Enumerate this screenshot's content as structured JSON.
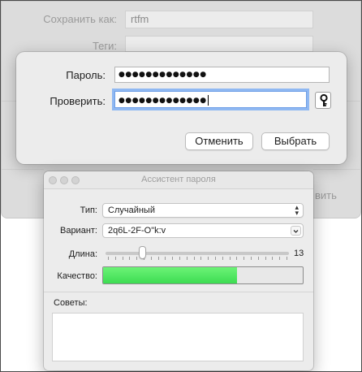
{
  "save_dialog": {
    "save_as_label": "Сохранить как:",
    "save_as_value": "rtfm",
    "tags_label": "Теги:",
    "partial_button": "вить"
  },
  "password_sheet": {
    "password_label": "Пароль:",
    "password_value": "●●●●●●●●●●●●●",
    "verify_label": "Проверить:",
    "verify_value": "●●●●●●●●●●●●●",
    "cancel_label": "Отменить",
    "choose_label": "Выбрать",
    "key_icon": "key-icon"
  },
  "assistant": {
    "title": "Ассистент пароля",
    "type_label": "Тип:",
    "type_value": "Случайный",
    "variant_label": "Вариант:",
    "variant_value": "2q6L-2F-O\"k:v",
    "length_label": "Длина:",
    "length_value": "13",
    "length_fraction": 0.2,
    "quality_label": "Качество:",
    "quality_fraction": 0.67,
    "quality_color": "#3ddc52",
    "tips_label": "Советы:"
  }
}
